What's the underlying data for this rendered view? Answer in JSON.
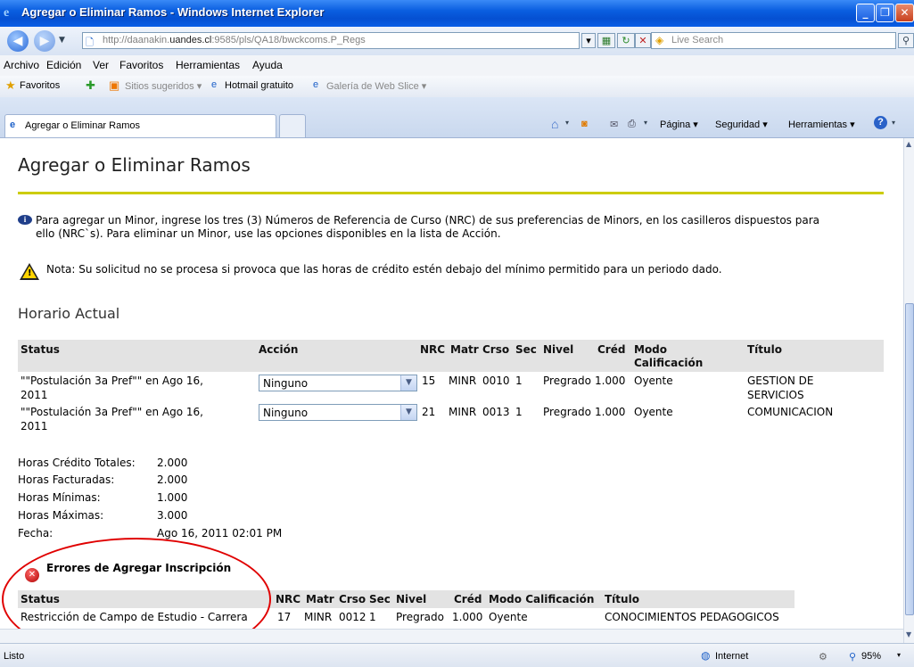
{
  "window": {
    "title": "Agregar o Eliminar Ramos - Windows Internet Explorer",
    "controls": [
      "_",
      "❐",
      "✕"
    ]
  },
  "address": {
    "url_prefix": "http://daanakin.",
    "url_domain": "uandes.cl",
    "url_suffix": ":9585/pls/QA18/bwckcoms.P_Regs",
    "search_placeholder": "Live Search"
  },
  "menu": [
    "Archivo",
    "Edición",
    "Ver",
    "Favoritos",
    "Herramientas",
    "Ayuda"
  ],
  "favorites": {
    "label": "Favoritos",
    "items": [
      "Sitios sugeridos ▾",
      "Hotmail gratuito",
      "Galería de Web Slice ▾"
    ]
  },
  "tab": {
    "label": "Agregar o Eliminar Ramos"
  },
  "commands": [
    "Página ▾",
    "Seguridad ▾",
    "Herramientas ▾"
  ],
  "page": {
    "title": "Agregar o Eliminar Ramos",
    "info_line1": "Para agregar un Minor, ingrese los tres (3) Números de Referencia de Curso (NRC) de sus preferencias de Minors, en los casilleros dispuestos para",
    "info_line2": "ello (NRC`s). Para eliminar un Minor, use las opciones disponibles en la lista de Acción.",
    "note": "Nota: Su solicitud no se procesa si provoca que las horas de crédito estén debajo del mínimo permitido para un periodo dado.",
    "schedule_title": "Horario Actual",
    "headers": {
      "status": "Status",
      "accion": "Acción",
      "nrc": "NRC",
      "matr": "Matr",
      "crso": "Crso",
      "sec": "Sec",
      "nivel": "Nivel",
      "cred": "Créd",
      "modo1": "Modo",
      "modo2": "Calificación",
      "titulo": "Título"
    },
    "rows": [
      {
        "status1": "\"\"Postulación 3a Pref\"\" en Ago 16,",
        "status2": "2011",
        "accion": "Ninguno",
        "nrc": "15",
        "matr": "MINR",
        "crso": "0010",
        "sec": "1",
        "nivel": "Pregrado",
        "cred": "1.000",
        "modo": "Oyente",
        "titulo1": "GESTION DE",
        "titulo2": "SERVICIOS"
      },
      {
        "status1": "\"\"Postulación 3a Pref\"\" en Ago 16,",
        "status2": "2011",
        "accion": "Ninguno",
        "nrc": "21",
        "matr": "MINR",
        "crso": "0013",
        "sec": "1",
        "nivel": "Pregrado",
        "cred": "1.000",
        "modo": "Oyente",
        "titulo1": "COMUNICACION",
        "titulo2": ""
      }
    ],
    "summary": [
      {
        "label": "Horas Crédito Totales:",
        "value": "2.000"
      },
      {
        "label": "Horas Facturadas:",
        "value": "2.000"
      },
      {
        "label": "Horas Mínimas:",
        "value": "1.000"
      },
      {
        "label": "Horas Máximas:",
        "value": "3.000"
      },
      {
        "label": "Fecha:",
        "value": "Ago 16, 2011 02:01 PM"
      }
    ],
    "errors_title": "Errores de Agregar Inscripción",
    "err_headers": {
      "status": "Status",
      "nrc": "NRC",
      "matr": "Matr",
      "crso": "Crso",
      "sec": "Sec",
      "nivel": "Nivel",
      "cred": "Créd",
      "modo": "Modo Calificación",
      "titulo": "Título"
    },
    "err_row": {
      "status": "Restricción de Campo de Estudio - Carrera",
      "nrc": "17",
      "matr": "MINR",
      "crso": "0012",
      "sec": "1",
      "nivel": "Pregrado",
      "cred": "1.000",
      "modo": "Oyente",
      "titulo": "CONOCIMIENTOS PEDAGOGICOS"
    }
  },
  "status": {
    "left": "Listo",
    "zone": "Internet",
    "zoom": "95%"
  },
  "colors": {
    "accent_rule": "#cccc00",
    "highlight_circle": "#e00000",
    "chrome_blue": "#0a5ee0"
  }
}
